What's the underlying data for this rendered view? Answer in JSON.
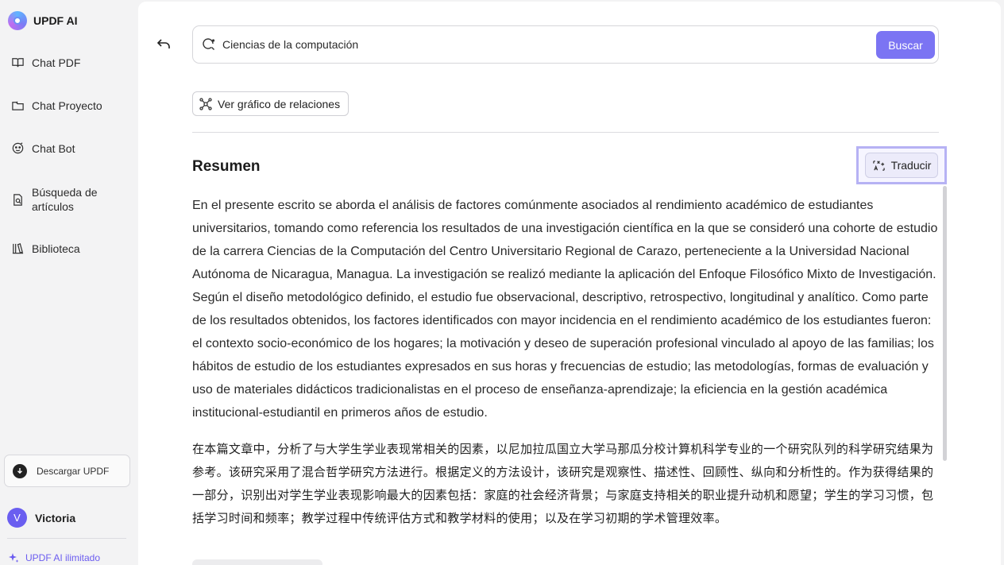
{
  "app": {
    "name": "UPDF AI"
  },
  "sidebar": {
    "items": [
      {
        "label": "Chat PDF",
        "icon": "book-open-icon"
      },
      {
        "label": "Chat Proyecto",
        "icon": "folder-icon"
      },
      {
        "label": "Chat Bot",
        "icon": "bot-icon"
      },
      {
        "label_line1": "Búsqueda de",
        "label_line2": "artículos",
        "icon": "doc-search-icon"
      },
      {
        "label": "Biblioteca",
        "icon": "library-icon"
      }
    ],
    "download_label": "Descargar UPDF",
    "user": {
      "initial": "V",
      "name": "Victoria"
    },
    "unlimited_label": "UPDF AI ilimitado"
  },
  "search": {
    "value": "Ciencias de la computación",
    "button_label": "Buscar"
  },
  "graph_button_label": "Ver gráfico de relaciones",
  "abstract": {
    "title": "Resumen",
    "translate_label": "Traducir",
    "text_es": "En el presente escrito se aborda el análisis de factores comúnmente asociados al rendimiento académico de estudiantes universitarios, tomando como referencia los resultados de una investigación científica en la que se consideró una cohorte de estudio de la carrera Ciencias de la Computación del Centro Universitario Regional de Carazo, perteneciente a la Universidad Nacional Autónoma de Nicaragua, Managua. La investigación se realizó mediante la aplicación del Enfoque Filosófico Mixto de Investigación. Según el diseño metodológico definido, el estudio fue observacional, descriptivo, retrospectivo, longitudinal y analítico. Como parte de los resultados obtenidos, los factores identificados con mayor incidencia en el rendimiento académico de los estudiantes fueron: el contexto socio-económico de los hogares; la motivación y deseo de superación profesional vinculado al apoyo de las familias; los hábitos de estudio de los estudiantes expresados en sus horas y frecuencias de estudio; las metodologías, formas de evaluación y uso de materiales didácticos tradicionalistas en el proceso de enseñanza-aprendizaje; la eficiencia en la gestión académica institucional-estudiantil en primeros años de estudio.",
    "text_zh": "在本篇文章中，分析了与大学生学业表现常相关的因素，以尼加拉瓜国立大学马那瓜分校计算机科学专业的一个研究队列的科学研究结果为参考。该研究采用了混合哲学研究方法进行。根据定义的方法设计，该研究是观察性、描述性、回顾性、纵向和分析性的。作为获得结果的一部分，识别出对学生学业表现影响最大的因素包括：家庭的社会经济背景；与家庭支持相关的职业提升动机和愿望；学生的学习习惯，包括学习时间和频率；教学过程中传统评估方式和教学材料的使用；以及在学习初期的学术管理效率。"
  },
  "colors": {
    "accent": "#7b74f3",
    "highlight_border": "#b6b2f4",
    "avatar": "#6a5ef0"
  }
}
